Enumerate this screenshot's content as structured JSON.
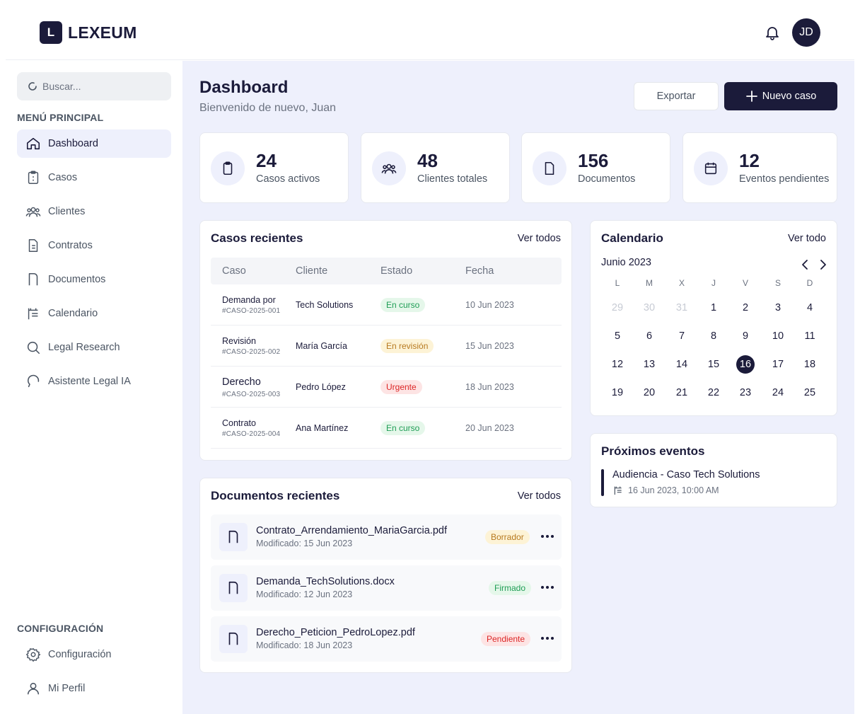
{
  "app": {
    "logo_letter": "L",
    "name": "LEXEUM"
  },
  "user": {
    "initials": "JD"
  },
  "search": {
    "placeholder": "Buscar..."
  },
  "sidebar": {
    "main_title": "MENÚ PRINCIPAL",
    "items": [
      {
        "label": "Dashboard",
        "icon": "home-icon"
      },
      {
        "label": "Casos",
        "icon": "clipboard-icon"
      },
      {
        "label": "Clientes",
        "icon": "users-icon"
      },
      {
        "label": "Contratos",
        "icon": "contract-icon"
      },
      {
        "label": "Documentos",
        "icon": "document-icon"
      },
      {
        "label": "Calendario",
        "icon": "calendar-icon"
      },
      {
        "label": "Legal Research",
        "icon": "search-icon"
      },
      {
        "label": "Asistente Legal IA",
        "icon": "chat-icon"
      }
    ],
    "config_title": "CONFIGURACIÓN",
    "config_items": [
      {
        "label": "Configuración",
        "icon": "gear-icon"
      },
      {
        "label": "Mi Perfil",
        "icon": "user-icon"
      }
    ]
  },
  "header": {
    "title": "Dashboard",
    "subtitle": "Bienvenido de nuevo, Juan",
    "export_label": "Exportar",
    "new_case_label": "Nuevo caso"
  },
  "stats": [
    {
      "value": "24",
      "label": "Casos activos",
      "icon": "clipboard-icon"
    },
    {
      "value": "48",
      "label": "Clientes totales",
      "icon": "users-icon"
    },
    {
      "value": "156",
      "label": "Documentos",
      "icon": "document-icon"
    },
    {
      "value": "12",
      "label": "Eventos pendientes",
      "icon": "calendar-icon"
    }
  ],
  "recent_cases": {
    "title": "Casos recientes",
    "link": "Ver todos",
    "columns": [
      "Caso",
      "Cliente",
      "Estado",
      "Fecha"
    ],
    "rows": [
      {
        "name": "Demanda por",
        "id": "#CASO-2025-001",
        "client": "Tech Solutions",
        "status": "En curso",
        "date": "10 Jun 2023"
      },
      {
        "name": "Revisión",
        "id": "#CASO-2025-002",
        "client": "María García",
        "status": "En revisión",
        "date": "15 Jun 2023"
      },
      {
        "name": "Derecho",
        "id": "#CASO-2025-003",
        "client": "Pedro López",
        "status": "Urgente",
        "date": "18 Jun 2023"
      },
      {
        "name": "Contrato",
        "id": "#CASO-2025-004",
        "client": "Ana Martínez",
        "status": "En curso",
        "date": "20 Jun 2023"
      }
    ]
  },
  "recent_docs": {
    "title": "Documentos recientes",
    "link": "Ver todos",
    "items": [
      {
        "name": "Contrato_Arrendamiento_MariaGarcia.pdf",
        "modified": "Modificado: 15 Jun 2023",
        "status": "Borrador"
      },
      {
        "name": "Demanda_TechSolutions.docx",
        "modified": "Modificado: 12 Jun 2023",
        "status": "Firmado"
      },
      {
        "name": "Derecho_Peticion_PedroLopez.pdf",
        "modified": "Modificado: 18 Jun 2023",
        "status": "Pendiente"
      }
    ]
  },
  "calendar": {
    "title": "Calendario",
    "link": "Ver todo",
    "month": "Junio 2023",
    "weekdays": [
      "L",
      "M",
      "X",
      "J",
      "V",
      "S",
      "D"
    ],
    "weeks": [
      [
        "29",
        "30",
        "31",
        "1",
        "2",
        "3",
        "4"
      ],
      [
        "5",
        "6",
        "7",
        "8",
        "9",
        "10",
        "11"
      ],
      [
        "12",
        "13",
        "14",
        "15",
        "16",
        "17",
        "18"
      ],
      [
        "19",
        "20",
        "21",
        "22",
        "23",
        "24",
        "25"
      ]
    ],
    "muted_days": [
      "29",
      "30",
      "31"
    ],
    "today": "16"
  },
  "events": {
    "title": "Próximos eventos",
    "items": [
      {
        "title": "Audiencia - Caso Tech Solutions",
        "date": "16 Jun 2023, 10:00 AM"
      }
    ]
  },
  "colors": {
    "brand": "#1b1b3a",
    "main_bg": "#eef0fc",
    "green": "#1f9d55",
    "yellow": "#b7791f",
    "red": "#dc2626"
  }
}
